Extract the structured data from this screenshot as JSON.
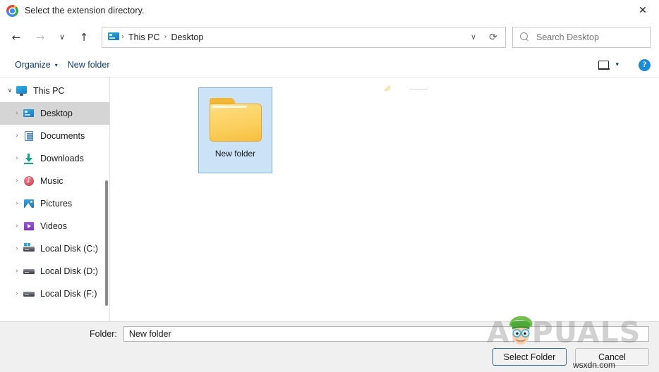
{
  "window": {
    "title": "Select the extension directory.",
    "app_icon": "chrome-icon",
    "close_label": "✕"
  },
  "nav": {
    "back": "←",
    "forward": "→",
    "recent": "∨",
    "up": "↑",
    "breadcrumb": {
      "root_icon": "this-pc-icon",
      "items": [
        "This PC",
        "Desktop"
      ],
      "separator": "›"
    },
    "history_caret": "∨",
    "refresh": "⟳"
  },
  "search": {
    "placeholder": "Search Desktop",
    "icon": "search-icon"
  },
  "toolbar": {
    "organize_label": "Organize",
    "organize_caret": "▾",
    "new_folder_label": "New folder",
    "view_icon": "preview-pane-icon",
    "view_caret": "▾",
    "help_label": "?"
  },
  "sidebar": {
    "items": [
      {
        "label": "This PC",
        "icon": "monitor-icon",
        "level": 0,
        "chevron": "∨",
        "selected": false
      },
      {
        "label": "Desktop",
        "icon": "desktop-icon",
        "level": 1,
        "chevron": "›",
        "selected": true
      },
      {
        "label": "Documents",
        "icon": "document-icon",
        "level": 1,
        "chevron": "›",
        "selected": false
      },
      {
        "label": "Downloads",
        "icon": "download-icon",
        "level": 1,
        "chevron": "›",
        "selected": false
      },
      {
        "label": "Music",
        "icon": "music-icon",
        "level": 1,
        "chevron": "›",
        "selected": false
      },
      {
        "label": "Pictures",
        "icon": "pictures-icon",
        "level": 1,
        "chevron": "›",
        "selected": false
      },
      {
        "label": "Videos",
        "icon": "videos-icon",
        "level": 1,
        "chevron": "›",
        "selected": false
      },
      {
        "label": "Local Disk (C:)",
        "icon": "windows-disk-icon",
        "level": 1,
        "chevron": "›",
        "selected": false
      },
      {
        "label": "Local Disk (D:)",
        "icon": "disk-icon",
        "level": 1,
        "chevron": "›",
        "selected": false
      },
      {
        "label": "Local Disk (F:)",
        "icon": "disk-icon",
        "level": 1,
        "chevron": "›",
        "selected": false
      }
    ]
  },
  "content": {
    "files": [
      {
        "name": "New folder",
        "icon": "folder-icon",
        "selected": true
      }
    ]
  },
  "footer": {
    "folder_label": "Folder:",
    "folder_value": "New folder",
    "select_label": "Select Folder",
    "cancel_label": "Cancel"
  },
  "watermark": {
    "brand": "APPUALS",
    "site": "wsxdn.com"
  },
  "colors": {
    "selection_fill": "#cce3f7",
    "selection_border": "#7cb2e0",
    "sidebar_selected": "#d5d5d5",
    "command_text": "#113f73",
    "help_blue": "#1c8ad4",
    "focus_border": "#2f6ba3",
    "folder_yellow": "#fbcf5d"
  }
}
